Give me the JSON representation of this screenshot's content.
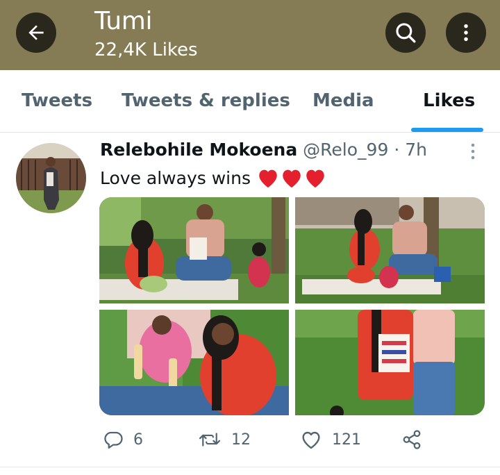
{
  "header": {
    "title": "Tumi",
    "subtitle": "22,4K Likes",
    "background_color": "#857b55",
    "icons": [
      "back-arrow-icon",
      "search-icon",
      "more-vertical-icon"
    ]
  },
  "tabs": [
    {
      "label": "Tweets",
      "active": false
    },
    {
      "label": "Tweets & replies",
      "active": false
    },
    {
      "label": "Media",
      "active": false
    },
    {
      "label": "Likes",
      "active": true
    }
  ],
  "accent_color": "#1d9bf0",
  "tweet": {
    "author_name": "Relebohile Mokoena",
    "author_handle": "@Relo_99",
    "separator": "·",
    "time": "7h",
    "text": "Love always wins",
    "text_emoji": "heart-emoji x3",
    "media_count": 4,
    "actions": {
      "replies": "6",
      "retweets": "12",
      "likes": "121"
    }
  }
}
